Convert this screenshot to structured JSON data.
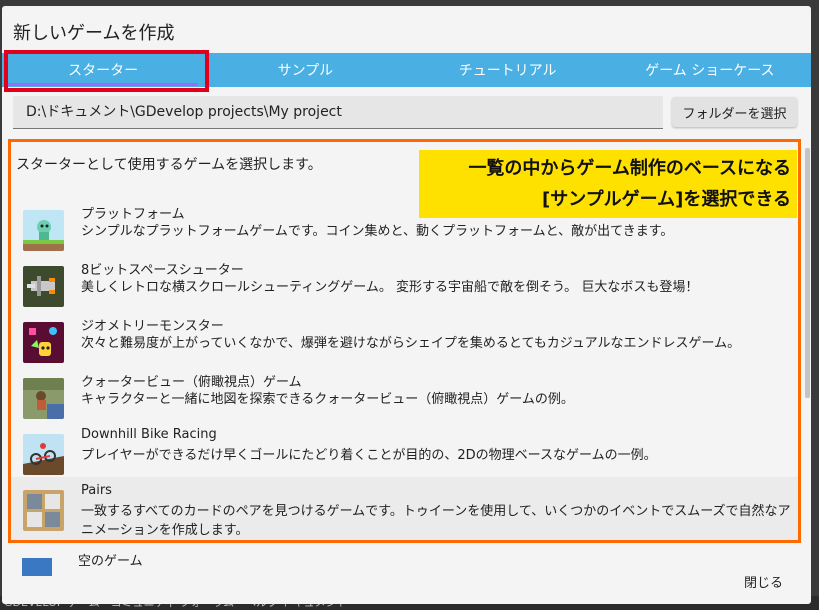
{
  "background_strip": "GDEVELOP ゲーム　コミュニティ フォーラム　ヘルプ ドキュメント",
  "dialog": {
    "title": "新しいゲームを作成",
    "tabs": [
      {
        "label": "スターター",
        "active": true
      },
      {
        "label": "サンプル",
        "active": false
      },
      {
        "label": "チュートリアル",
        "active": false
      },
      {
        "label": "ゲーム ショーケース",
        "active": false
      }
    ],
    "path": {
      "value": "D:\\ドキュメント\\GDevelop projects\\My project",
      "button_label": "フォルダーを選択"
    },
    "intro": "スターターとして使用するゲームを選択します。",
    "callout": {
      "line1": "一覧の中からゲーム制作のベースになる",
      "line2": "[サンプルゲーム]を選択できる"
    },
    "starters": [
      {
        "title": "プラットフォーム",
        "description": "シンプルなプラットフォームゲームです。コイン集めと、動くプラットフォームと、敵が出てきます。",
        "icon": "platformer-thumb"
      },
      {
        "title": "8ビットスペースシューター",
        "description": "美しくレトロな横スクロールシューティングゲーム。 変形する宇宙船で敵を倒そう。 巨大なボスも登場！",
        "icon": "space-shooter-thumb"
      },
      {
        "title": "ジオメトリーモンスター",
        "description": "次々と難易度が上がっていくなかで、爆弾を避けながらシェイプを集めるとてもカジュアルなエンドレスゲーム。",
        "icon": "geometry-monster-thumb"
      },
      {
        "title": "クォータービュー（俯瞰視点）ゲーム",
        "description": "キャラクターと一緒に地図を探索できるクォータービュー（俯瞰視点）ゲームの例。",
        "icon": "top-down-thumb"
      },
      {
        "title": "Downhill Bike Racing",
        "description": "プレイヤーができるだけ早くゴールにたどり着くことが目的の、2Dの物理ベースなゲームの一例。",
        "icon": "bike-racing-thumb"
      },
      {
        "title": "Pairs",
        "description": "一致するすべてのカードのペアを見つけるゲームです。トゥイーンを使用して、いくつかのイベントでスムーズで自然なアニメーションを作成します。",
        "icon": "pairs-thumb"
      }
    ],
    "partial_item": "空のゲーム",
    "close_label": "閉じる"
  },
  "colors": {
    "tab_bar": "#4ab0e4",
    "tab_highlight_border": "#e0001b",
    "list_highlight_border": "#ff6a00",
    "callout_bg": "#ffe100"
  }
}
